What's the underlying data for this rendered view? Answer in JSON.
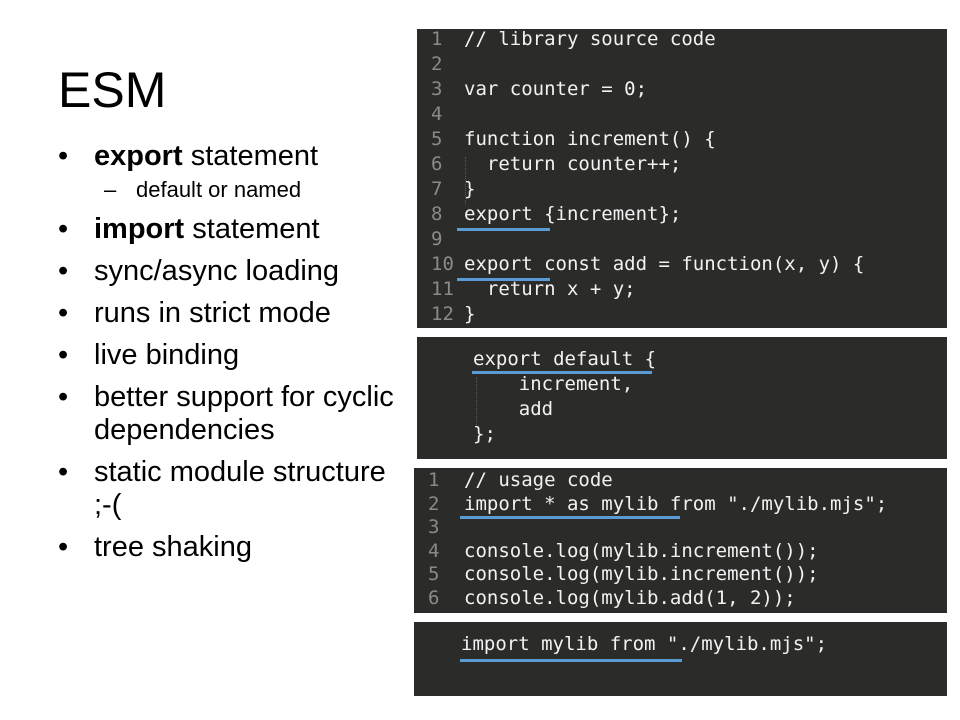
{
  "slide": {
    "title": "ESM",
    "bullets": [
      {
        "bold": "export",
        "rest": " statement"
      },
      {
        "sub": "default or named"
      },
      {
        "bold": "import",
        "rest": " statement"
      },
      {
        "text": "sync/async loading"
      },
      {
        "text": "runs in strict mode"
      },
      {
        "text": "live binding"
      },
      {
        "text": "better support for cyclic dependencies"
      },
      {
        "text": "static module structure ;-("
      },
      {
        "text": "tree shaking"
      }
    ],
    "bullet_char": "•",
    "sub_bullet_char": "–"
  },
  "code1": {
    "lines": [
      {
        "n": "1",
        "t": "// library source code"
      },
      {
        "n": "2",
        "t": ""
      },
      {
        "n": "3",
        "t": "var counter = 0;"
      },
      {
        "n": "4",
        "t": ""
      },
      {
        "n": "5",
        "t": "function increment() {"
      },
      {
        "n": "6",
        "t": "  return counter++;"
      },
      {
        "n": "7",
        "t": "}"
      },
      {
        "n": "8",
        "t": "export {increment};"
      },
      {
        "n": "9",
        "t": ""
      },
      {
        "n": "10",
        "t": "export const add = function(x, y) {"
      },
      {
        "n": "11",
        "t": "  return x + y;"
      },
      {
        "n": "12",
        "t": "}"
      }
    ]
  },
  "code2": {
    "lines": [
      "export default {",
      "    increment,",
      "    add",
      "};"
    ]
  },
  "code3": {
    "lines": [
      {
        "n": "1",
        "t": "// usage code"
      },
      {
        "n": "2",
        "t": "import * as mylib from \"./mylib.mjs\";"
      },
      {
        "n": "3",
        "t": ""
      },
      {
        "n": "4",
        "t": "console.log(mylib.increment());"
      },
      {
        "n": "5",
        "t": "console.log(mylib.increment());"
      },
      {
        "n": "6",
        "t": "console.log(mylib.add(1, 2));"
      }
    ]
  },
  "code4": {
    "lines": [
      "import mylib from \"./mylib.mjs\";"
    ]
  },
  "colors": {
    "code_background": "#2b2b29",
    "code_text": "#f2f2f2",
    "line_number": "#8a8a8a",
    "underline_accent": "#5b9bd5"
  }
}
